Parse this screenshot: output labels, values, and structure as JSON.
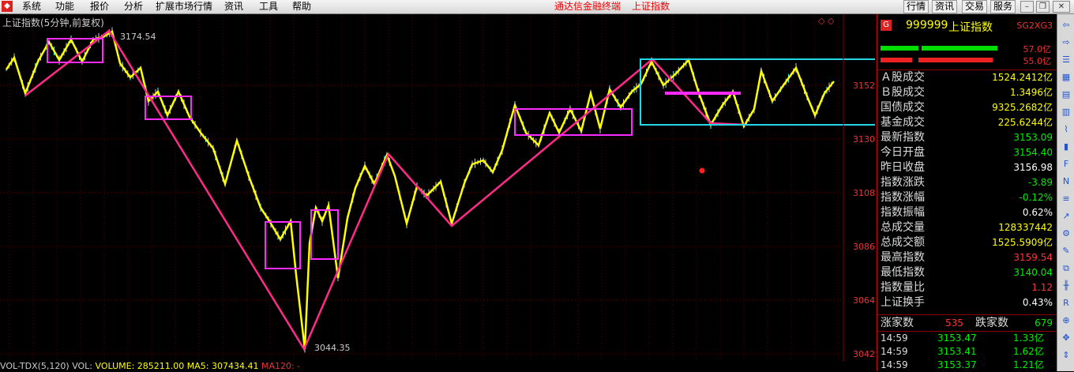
{
  "menubar": {
    "items": [
      "系统",
      "功能",
      "报价",
      "分析",
      "扩展市场行情",
      "资讯",
      "工具",
      "帮助"
    ],
    "brand": "通达信金融终端",
    "title": "上证指数",
    "right_buttons": [
      "行情",
      "资讯",
      "交易",
      "服务"
    ]
  },
  "chart": {
    "title": "上证指数(5分钟,前复权)",
    "high_label": "3174.54",
    "low_label": "3044.35",
    "y_ticks": [
      "3152",
      "3130",
      "3108",
      "3086",
      "3064",
      "3042"
    ],
    "corner_mark": "◇ ◇"
  },
  "indicator_bar": {
    "name": "VOL-TDX(5,120)",
    "vol_label": "VOL:",
    "volume": "VOLUME: 285211.00",
    "ma5": "MA5: 307434.41",
    "ma120": "MA120: -"
  },
  "panel": {
    "badge": "G",
    "code": "999999",
    "name": "上证指数",
    "code2": "SG2XG3",
    "bar1_value": "57.0亿",
    "bar2_value": "55.0亿",
    "rows": [
      {
        "label": "Ａ股成交",
        "value": "1524.2412亿",
        "color": "#ffff00"
      },
      {
        "label": "Ｂ股成交",
        "value": "1.3496亿",
        "color": "#ffff00"
      },
      {
        "label": "国债成交",
        "value": "9325.2682亿",
        "color": "#ffff00"
      },
      {
        "label": "基金成交",
        "value": "225.6244亿",
        "color": "#ffff00"
      },
      {
        "label": "最新指数",
        "value": "3153.09",
        "color": "#00ee00"
      },
      {
        "label": "今日开盘",
        "value": "3154.40",
        "color": "#00ee00"
      },
      {
        "label": "昨日收盘",
        "value": "3156.98",
        "color": "#ffffff"
      },
      {
        "label": "指数涨跌",
        "value": "-3.89",
        "color": "#00ee00"
      },
      {
        "label": "指数涨幅",
        "value": "-0.12%",
        "color": "#00ee00"
      },
      {
        "label": "指数振幅",
        "value": "0.62%",
        "color": "#ffffff"
      },
      {
        "label": "总成交量",
        "value": "128337442",
        "color": "#ffff00"
      },
      {
        "label": "总成交额",
        "value": "1525.5909亿",
        "color": "#ffff00"
      },
      {
        "label": "最高指数",
        "value": "3159.54",
        "color": "#ff3333"
      },
      {
        "label": "最低指数",
        "value": "3140.04",
        "color": "#00ee00"
      },
      {
        "label": "指数量比",
        "value": "1.12",
        "color": "#ff3333"
      },
      {
        "label": "上证换手",
        "value": "0.43%",
        "color": "#ffffff"
      }
    ],
    "up_label": "涨家数",
    "up_value": "535",
    "down_label": "跌家数",
    "down_value": "679",
    "ticks": [
      {
        "time": "14:59",
        "price": "3153.47",
        "amount": "1.33亿"
      },
      {
        "time": "14:59",
        "price": "3153.41",
        "amount": "1.62亿"
      },
      {
        "time": "14:59",
        "price": "3153.37",
        "amount": "1.21亿"
      }
    ]
  },
  "colors": {
    "up": "#ff3333",
    "down": "#00ee00",
    "yellow": "#ffff00",
    "pink": "#ff2a8a",
    "magenta": "#ff2aff",
    "cyan": "#22d8e8"
  }
}
